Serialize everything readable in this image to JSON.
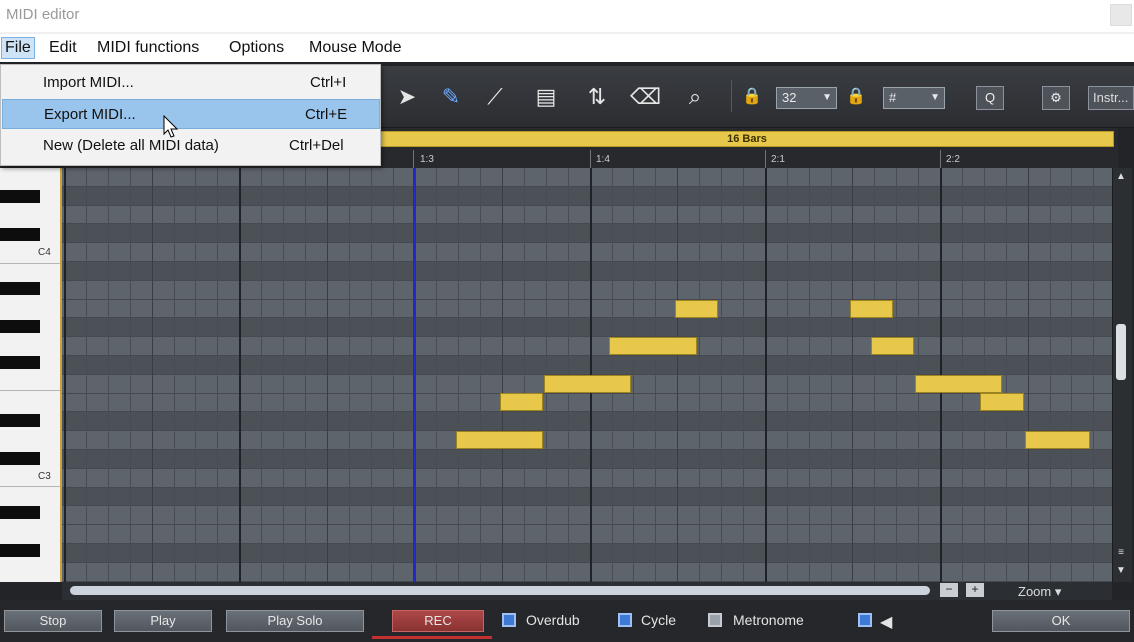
{
  "window": {
    "title": "MIDI editor"
  },
  "menubar": {
    "items": [
      {
        "label": "File",
        "active": true
      },
      {
        "label": "Edit"
      },
      {
        "label": "MIDI functions"
      },
      {
        "label": "Options"
      },
      {
        "label": "Mouse Mode"
      }
    ]
  },
  "file_menu": {
    "items": [
      {
        "label": "Import MIDI...",
        "shortcut": "Ctrl+I"
      },
      {
        "label": "Export MIDI...",
        "shortcut": "Ctrl+E",
        "highlighted": true
      },
      {
        "label": "New (Delete all MIDI data)",
        "shortcut": "Ctrl+Del"
      }
    ]
  },
  "toolbar": {
    "tools": [
      "select-arrow-icon",
      "pencil-icon",
      "line-draw-icon",
      "velocity-draw-icon",
      "split-move-icon",
      "eraser-icon",
      "zoom-magnifier-icon"
    ],
    "grid_value": "32",
    "snap_value": "#",
    "quantize_label": "Q",
    "settings_icon": "gear-icon",
    "instrument_label": "Instr..."
  },
  "ruler": {
    "length_label": "16 Bars",
    "bar_labels": [
      "1:3",
      "1:4",
      "2:1",
      "2:2"
    ]
  },
  "keyboard": {
    "labels": [
      "C4",
      "C3"
    ]
  },
  "notes": [
    {
      "start": 1.6875,
      "length": 0.25,
      "pitch": "B3"
    },
    {
      "start": 1.7375,
      "length": 0.25,
      "pitch": "G3"
    },
    {
      "start": 1.8125,
      "length": 0.25,
      "pitch": "E3"
    },
    {
      "start": 1.9375,
      "length": 0.25,
      "pitch": "F3"
    },
    {
      "start": 2.0625,
      "length": 0.25,
      "pitch": "D3"
    }
  ],
  "scroll": {
    "zoom_label": "Zoom"
  },
  "transport": {
    "stop": "Stop",
    "play": "Play",
    "play_solo": "Play Solo",
    "rec": "REC",
    "overdub": "Overdub",
    "cycle": "Cycle",
    "metronome": "Metronome",
    "ok": "OK"
  },
  "colors": {
    "note_fill": "#e7c84a",
    "grid_bg": "#5a6068",
    "playhead": "#2029c8",
    "menu_highlight": "#99c4ec"
  }
}
